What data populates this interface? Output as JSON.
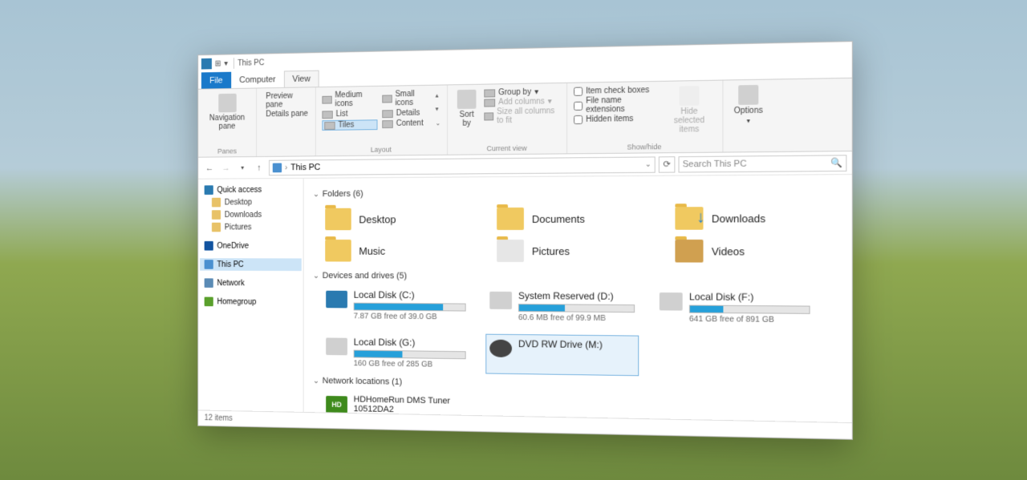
{
  "title": "This PC",
  "tabs": {
    "file": "File",
    "computer": "Computer",
    "view": "View"
  },
  "ribbon": {
    "panes": {
      "group": "Panes",
      "nav": "Navigation\npane",
      "preview": "Preview pane",
      "details": "Details pane"
    },
    "layout": {
      "group": "Layout",
      "medium": "Medium icons",
      "small": "Small icons",
      "list": "List",
      "details": "Details",
      "tiles": "Tiles",
      "content": "Content"
    },
    "currentview": {
      "group": "Current view",
      "sort": "Sort\nby",
      "group_by": "Group by",
      "addcols": "Add columns",
      "sizefit": "Size all columns to fit"
    },
    "showhide": {
      "group": "Show/hide",
      "itemcheck": "Item check boxes",
      "fileext": "File name extensions",
      "hidden": "Hidden items",
      "hidesel": "Hide selected\nitems"
    },
    "options": "Options"
  },
  "breadcrumb": {
    "root": "This PC"
  },
  "search_placeholder": "Search This PC",
  "sidebar": {
    "quick": "Quick access",
    "desktop": "Desktop",
    "downloads": "Downloads",
    "pictures": "Pictures",
    "onedrive": "OneDrive",
    "thispc": "This PC",
    "network": "Network",
    "homegroup": "Homegroup"
  },
  "sections": {
    "folders": {
      "label": "Folders (6)",
      "items": [
        {
          "name": "Desktop"
        },
        {
          "name": "Documents"
        },
        {
          "name": "Downloads"
        },
        {
          "name": "Music"
        },
        {
          "name": "Pictures"
        },
        {
          "name": "Videos"
        }
      ]
    },
    "drives": {
      "label": "Devices and drives (5)",
      "items": [
        {
          "name": "Local Disk (C:)",
          "free": "7.87 GB free of 39.0 GB",
          "pct": 80,
          "icon": "win"
        },
        {
          "name": "System Reserved (D:)",
          "free": "60.6 MB free of 99.9 MB",
          "pct": 40,
          "icon": "disk"
        },
        {
          "name": "Local Disk (F:)",
          "free": "641 GB free of 891 GB",
          "pct": 28,
          "icon": "disk"
        },
        {
          "name": "Local Disk (G:)",
          "free": "160 GB free of 285 GB",
          "pct": 44,
          "icon": "disk"
        },
        {
          "name": "DVD RW Drive (M:)",
          "free": "",
          "pct": 0,
          "icon": "dvd",
          "selected": true
        }
      ]
    },
    "netloc": {
      "label": "Network locations (1)",
      "items": [
        {
          "name": "HDHomeRun DMS Tuner 10512DA2"
        }
      ]
    }
  },
  "status": "12 items"
}
